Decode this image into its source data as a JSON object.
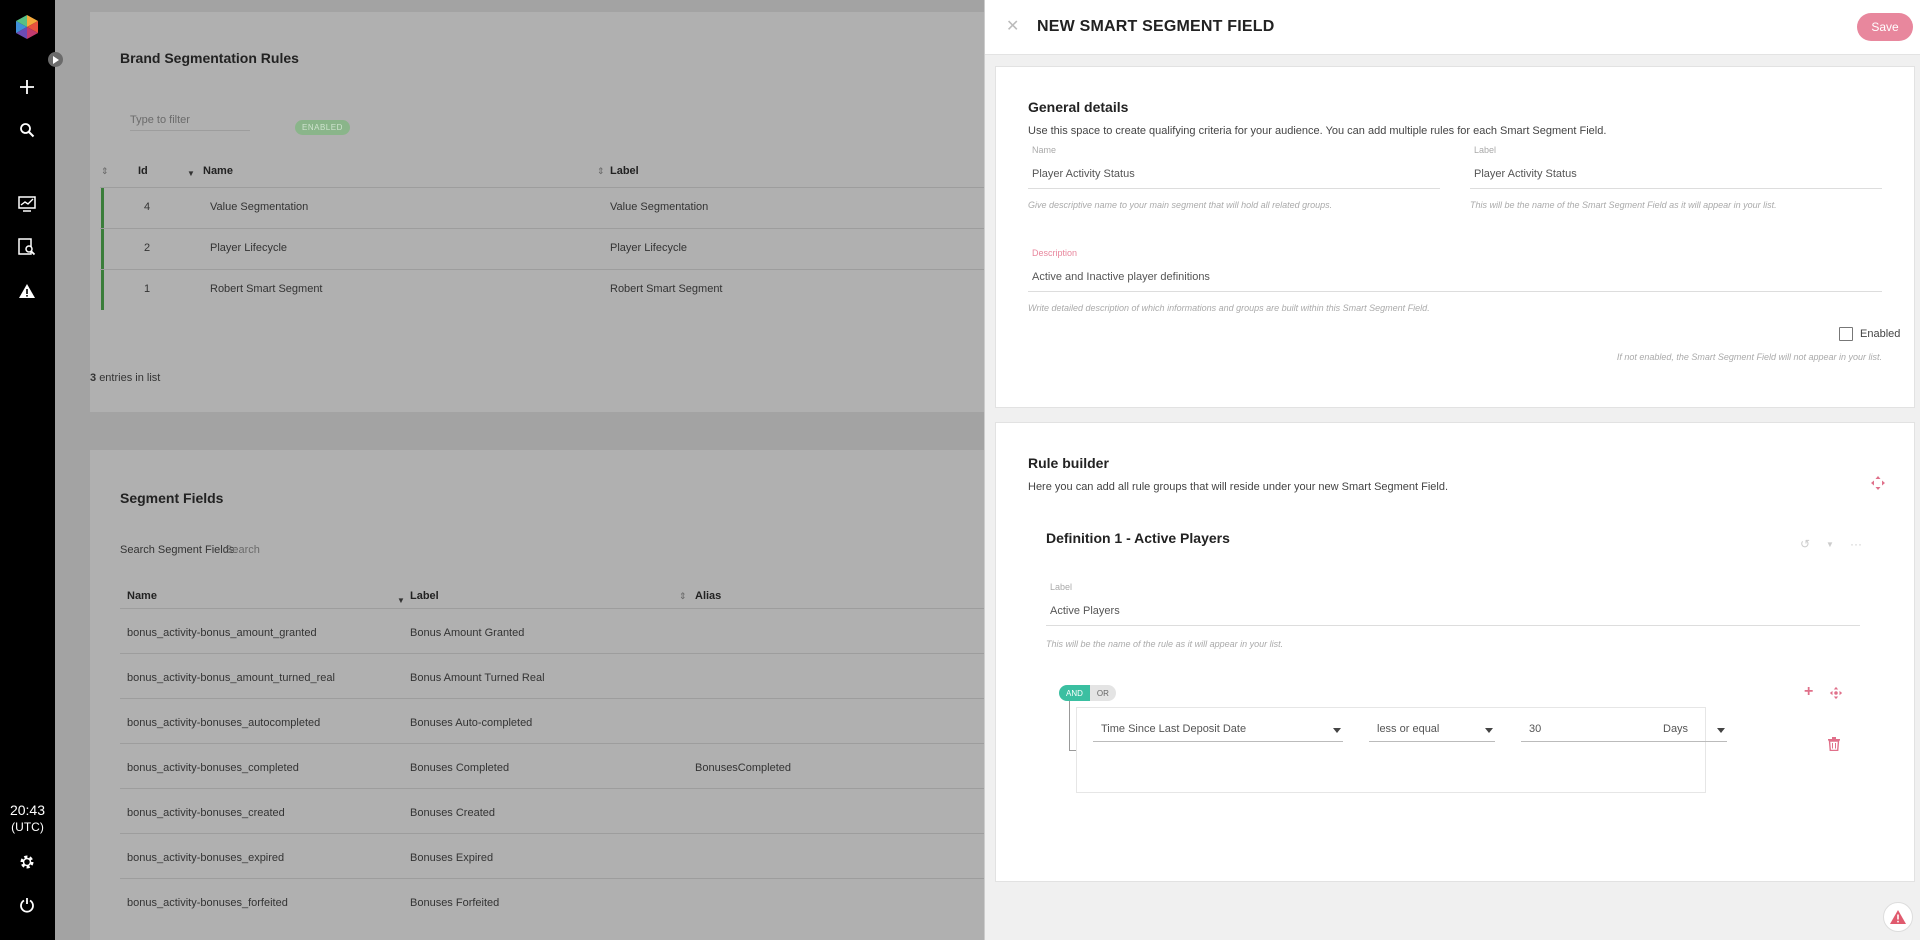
{
  "clock": {
    "time": "20:43",
    "zone": "(UTC)"
  },
  "rules_card": {
    "title": "Brand Segmentation Rules",
    "filter_placeholder": "Type to filter",
    "badge": "ENABLED",
    "columns": [
      "Id",
      "Name",
      "Label"
    ],
    "rows": [
      {
        "id": "4",
        "name": "Value Segmentation",
        "label": "Value Segmentation"
      },
      {
        "id": "2",
        "name": "Player Lifecycle",
        "label": "Player Lifecycle"
      },
      {
        "id": "1",
        "name": "Robert Smart Segment",
        "label": "Robert Smart Segment"
      }
    ],
    "entries_count": "3",
    "entries_text": "entries in list"
  },
  "fields_card": {
    "title": "Segment Fields",
    "search_label": "Search Segment Fields:",
    "search_placeholder": "Search",
    "columns": [
      "Name",
      "Label",
      "Alias"
    ],
    "rows": [
      {
        "name": "bonus_activity-bonus_amount_granted",
        "label": "Bonus Amount Granted",
        "alias": ""
      },
      {
        "name": "bonus_activity-bonus_amount_turned_real",
        "label": "Bonus Amount Turned Real",
        "alias": ""
      },
      {
        "name": "bonus_activity-bonuses_autocompleted",
        "label": "Bonuses Auto-completed",
        "alias": ""
      },
      {
        "name": "bonus_activity-bonuses_completed",
        "label": "Bonuses Completed",
        "alias": "BonusesCompleted"
      },
      {
        "name": "bonus_activity-bonuses_created",
        "label": "Bonuses Created",
        "alias": ""
      },
      {
        "name": "bonus_activity-bonuses_expired",
        "label": "Bonuses Expired",
        "alias": ""
      },
      {
        "name": "bonus_activity-bonuses_forfeited",
        "label": "Bonuses Forfeited",
        "alias": ""
      }
    ]
  },
  "drawer": {
    "close": "✕",
    "title": "NEW SMART SEGMENT FIELD",
    "save_label": "Save",
    "general": {
      "title": "General details",
      "description": "Use this space to create qualifying criteria for your audience. You can add multiple rules for each Smart Segment Field.",
      "name_label": "Name",
      "name_value": "Player Activity Status",
      "name_hint": "Give descriptive name to your main segment that will hold all related groups.",
      "label_label": "Label",
      "label_value": "Player Activity Status",
      "label_hint": "This will be the name of the Smart Segment Field as it will appear in your list.",
      "desc_label": "Description",
      "desc_value": "Active and Inactive player definitions",
      "desc_hint": "Write detailed description of which informations and groups are built within this Smart Segment Field.",
      "enabled_label": "Enabled",
      "enabled_hint": "If not enabled, the Smart Segment Field will not appear in your list."
    },
    "rules": {
      "title": "Rule builder",
      "description": "Here you can add all rule groups that will reside under your new Smart Segment Field.",
      "definition_title": "Definition 1 - Active Players",
      "label_label": "Label",
      "label_value": "Active Players",
      "label_hint": "This will be the name of the rule as it will appear in your list.",
      "and_label": "AND",
      "or_label": "OR",
      "field_value": "Time Since Last Deposit Date",
      "operator_value": "less or equal",
      "amount_value": "30",
      "unit_value": "Days"
    }
  },
  "colors": {
    "accent": "#e8879d",
    "and_toggle": "#3bbfa1",
    "nav_bg": "#000000"
  }
}
